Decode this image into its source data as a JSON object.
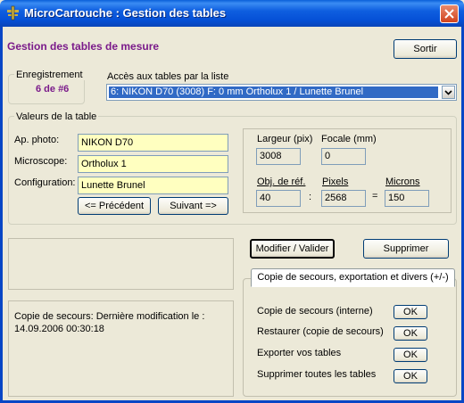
{
  "window": {
    "title": "MicroCartouche : Gestion des tables"
  },
  "header": {
    "heading": "Gestion des tables de mesure",
    "exit_label": "Sortir"
  },
  "record": {
    "label": "Enregistrement",
    "value": "6 de #6"
  },
  "list_access": {
    "label": "Accès aux tables par la liste",
    "selected": "6: NIKON D70  (3008)  F: 0 mm   Ortholux 1 / Lunette Brunel"
  },
  "table_values": {
    "group_label": "Valeurs de la table",
    "photo_label": "Ap. photo:",
    "photo_value": "NIKON D70",
    "microscope_label": "Microscope:",
    "microscope_value": "Ortholux 1",
    "config_label": "Configuration:",
    "config_value": "Lunette Brunel",
    "prev_label": "<= Précédent",
    "next_label": "Suivant =>",
    "width_label": "Largeur (pix)",
    "width_value": "3008",
    "focal_label": "Focale (mm)",
    "focal_value": "0",
    "obj_label": "Obj. de réf.",
    "obj_value": "40",
    "colon": ":",
    "pixels_label": "Pixels",
    "pixels_value": "2568",
    "equals": "=",
    "microns_label": "Microns",
    "microns_value": "150"
  },
  "actions": {
    "modify_label": "Modifier / Valider",
    "delete_label": "Supprimer"
  },
  "backup": {
    "tab_label": "Copie de secours, exportation et divers (+/-)",
    "status_text": "Copie de secours: Dernière modification le : 14.09.2006 00:30:18",
    "items": [
      {
        "label": "Copie de secours (interne)",
        "button": "OK"
      },
      {
        "label": "Restaurer (copie de secours)",
        "button": "OK"
      },
      {
        "label": "Exporter vos tables",
        "button": "OK"
      },
      {
        "label": "Supprimer toutes les tables",
        "button": "OK"
      }
    ]
  },
  "colors": {
    "heading": "#7a1a8a",
    "record_value": "#7a1a8a",
    "input_bg": "#ffffc0",
    "titlebar": "#0a5fd9"
  },
  "icons": {
    "app": "cross-icon",
    "close": "close-icon",
    "dropdown": "chevron-down-icon"
  }
}
